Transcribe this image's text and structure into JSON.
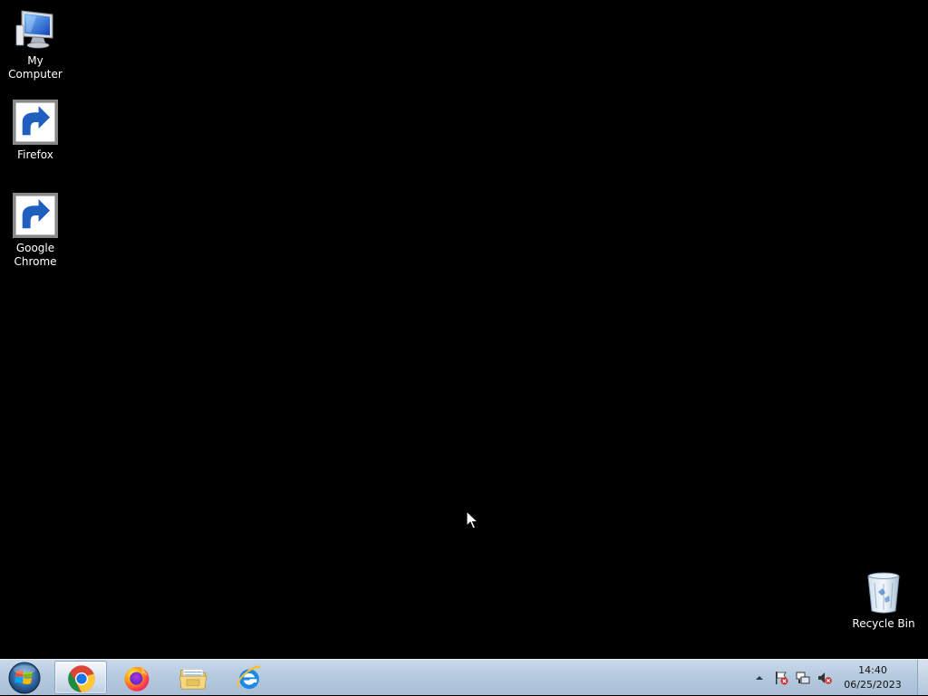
{
  "desktop": {
    "background_color": "#000000",
    "icons": [
      {
        "label": "My Computer",
        "icon": "computer-icon",
        "shortcut": false
      },
      {
        "label": "Firefox",
        "icon": "firefox-icon",
        "shortcut": true
      },
      {
        "label": "Google Chrome",
        "icon": "chrome-icon",
        "shortcut": true
      },
      {
        "label": "Recycle Bin",
        "icon": "recycle-bin-icon",
        "shortcut": false
      }
    ]
  },
  "taskbar": {
    "start_button": {
      "icon": "windows-logo-icon"
    },
    "pinned": [
      {
        "name": "Google Chrome",
        "icon": "chrome-icon",
        "active": true
      },
      {
        "name": "Firefox",
        "icon": "firefox-icon",
        "active": false
      },
      {
        "name": "Windows Explorer",
        "icon": "folder-icon",
        "active": false
      },
      {
        "name": "Internet Explorer",
        "icon": "internet-explorer-icon",
        "active": false
      }
    ],
    "tray": {
      "icons": [
        "show-hidden-icons-arrow",
        "action-center-flag-icon",
        "network-icon",
        "volume-muted-icon"
      ],
      "time": "14:40",
      "date": "06/25/2023"
    }
  },
  "colors": {
    "taskbar_top": "#c9d9ea",
    "taskbar_bottom": "#a9bfd6",
    "label_text": "#ffffff"
  }
}
